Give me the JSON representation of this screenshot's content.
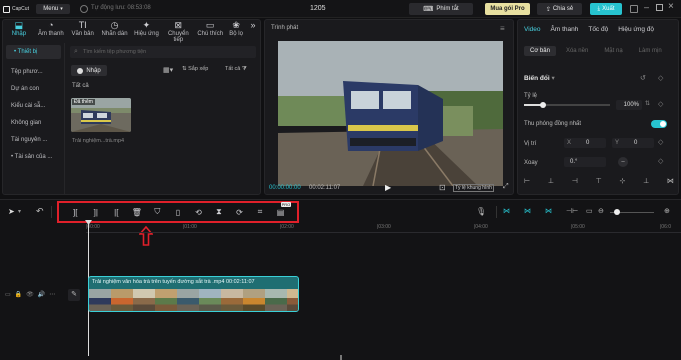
{
  "app": {
    "logo": "CapCut",
    "menu": "Menu",
    "autosave": "Tự động lưu: 08:53:08",
    "project_title": "1205"
  },
  "header_buttons": {
    "shortcuts": "Phím tắt",
    "buy_pro": "Mua gói Pro",
    "share": "Chia sẻ",
    "export": "Xuất"
  },
  "media_tabs": [
    {
      "label": "Nhập",
      "icon": "import-icon"
    },
    {
      "label": "Âm thanh",
      "icon": "audio-icon"
    },
    {
      "label": "Văn bản",
      "icon": "text-icon"
    },
    {
      "label": "Nhãn dán",
      "icon": "sticker-icon"
    },
    {
      "label": "Hiệu ứng",
      "icon": "effects-icon"
    },
    {
      "label": "Chuyển tiếp",
      "icon": "transition-icon"
    },
    {
      "label": "Chú thích",
      "icon": "caption-icon"
    },
    {
      "label": "Bộ lọ",
      "icon": "filter-icon"
    }
  ],
  "sidebar": {
    "items": [
      "• Thiết bị",
      "Tệp phươ...",
      "Dự án con",
      "Kiểu cài sẵ...",
      "Không gian",
      "Tài nguyên ...",
      "• Tài sản của ..."
    ]
  },
  "media": {
    "search_placeholder": "Tìm kiếm tệp phương tiện",
    "import_button": "Nhập",
    "sort_label": "Sắp xếp",
    "filter_label": "Tất cả",
    "section_label": "Tất cả",
    "clip_badge": "Đã thêm",
    "clip_name": "Trải nghiệm...trà.mp4"
  },
  "player": {
    "title": "Trình phát",
    "time_current": "00:00:00:00",
    "time_total": "00:02:11:07",
    "ratio_label": "Tỷ lệ khung hình"
  },
  "inspector": {
    "tabs": [
      "Video",
      "Âm thanh",
      "Tốc độ",
      "Hiệu ứng độ"
    ],
    "subtabs": [
      "Cơ bản",
      "Xóa nền",
      "Mặt nạ",
      "Làm mịn"
    ],
    "transform_label": "Biến đổi",
    "scale_label": "Tỷ lệ",
    "scale_value": "100%",
    "scale_fraction": 0.22,
    "uniform_scale_label": "Thu phóng đồng nhất",
    "position_label": "Vị trí",
    "x_label": "X",
    "x_value": "0",
    "y_label": "Y",
    "y_value": "0",
    "rotate_label": "Xoay",
    "rotate_value": "0.°"
  },
  "timeline": {
    "ruler_ticks": [
      "|00:00",
      "|01:00",
      "|02:00",
      "|03:00",
      "|04:00",
      "|05:00",
      "|06:0"
    ],
    "clip_title": "Trải nghiệm văn hóa trà trên tuyến đường sắt trà .mp4",
    "clip_duration": "00:02:11:07",
    "toolbar_icons": [
      "split-icon",
      "split-left-icon",
      "split-right-icon",
      "delete-icon",
      "mask-shield-icon",
      "freeze-icon",
      "reverse-icon",
      "mirror-icon",
      "rotate-icon",
      "crop-icon",
      "ai-retouch-pro-icon"
    ],
    "pro_badge": "PRO",
    "highlight_color": "#e0202a"
  }
}
